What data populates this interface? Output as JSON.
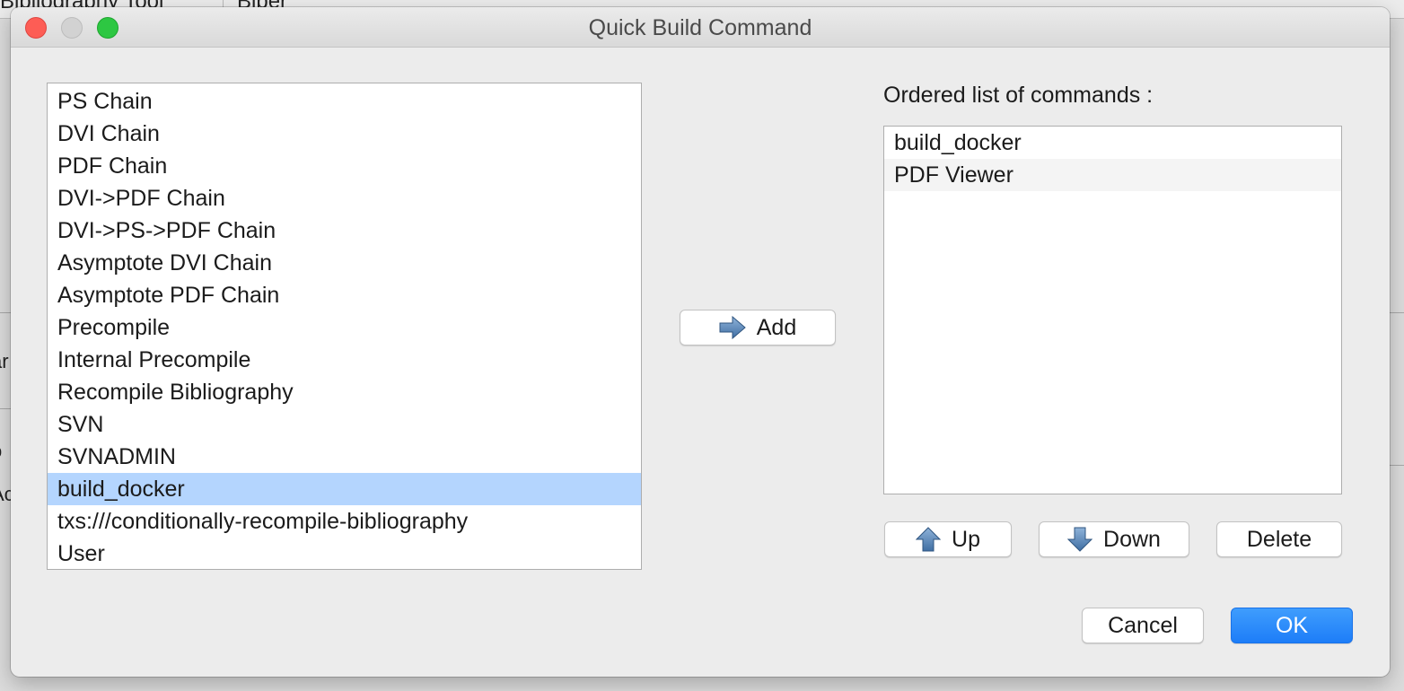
{
  "background": {
    "tab_left_fragment": "Bibliography Tool",
    "tab_right_fragment": "Biber",
    "side_fragment_1": "ar",
    "side_fragment_2": "o",
    "side_fragment_3": "Ac"
  },
  "dialog": {
    "title": "Quick Build Command"
  },
  "available_commands": {
    "items": [
      "PS Chain",
      "DVI Chain",
      "PDF Chain",
      "DVI->PDF Chain",
      "DVI->PS->PDF Chain",
      "Asymptote DVI Chain",
      "Asymptote PDF Chain",
      "Precompile",
      "Internal Precompile",
      "Recompile Bibliography",
      "SVN",
      "SVNADMIN",
      "build_docker",
      "txs:///conditionally-recompile-bibliography",
      "User"
    ],
    "selected": "build_docker"
  },
  "ordered": {
    "label": "Ordered list of commands :",
    "items": [
      "build_docker",
      "PDF Viewer"
    ]
  },
  "buttons": {
    "add": "Add",
    "up": "Up",
    "down": "Down",
    "delete": "Delete",
    "cancel": "Cancel",
    "ok": "OK"
  },
  "icons": {
    "add": "arrow-right-icon",
    "up": "arrow-up-icon",
    "down": "arrow-down-icon"
  },
  "colors": {
    "selection": "#b4d5fe",
    "ok_button": "#1d7df8",
    "close": "#fd5d55",
    "maximize": "#2dc742"
  }
}
